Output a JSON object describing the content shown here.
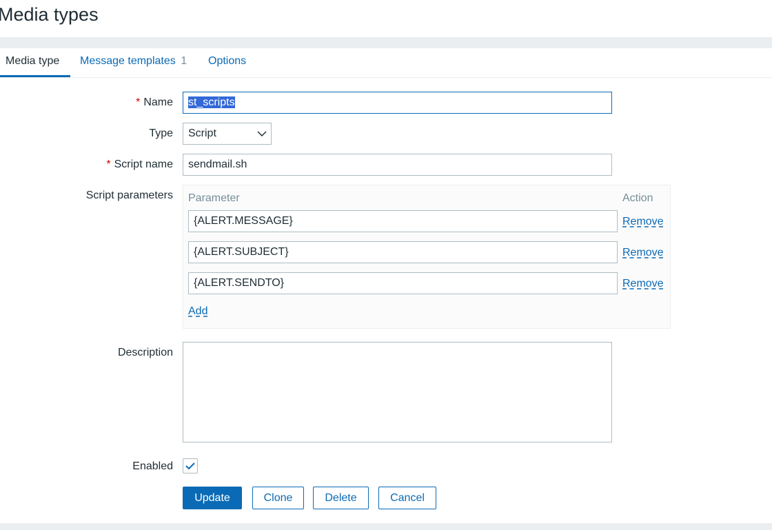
{
  "page": {
    "title": "Media types"
  },
  "tabs": [
    {
      "label": "Media type",
      "active": true
    },
    {
      "label": "Message templates",
      "count": "1"
    },
    {
      "label": "Options"
    }
  ],
  "form": {
    "name": {
      "label": "Name",
      "value": "st_scripts"
    },
    "type": {
      "label": "Type",
      "value": "Script"
    },
    "script_name": {
      "label": "Script name",
      "value": "sendmail.sh"
    },
    "script_parameters": {
      "label": "Script parameters",
      "col_parameter": "Parameter",
      "col_action": "Action",
      "rows": [
        {
          "value": "{ALERT.MESSAGE}",
          "action": "Remove"
        },
        {
          "value": "{ALERT.SUBJECT}",
          "action": "Remove"
        },
        {
          "value": "{ALERT.SENDTO}",
          "action": "Remove"
        }
      ],
      "add_label": "Add"
    },
    "description": {
      "label": "Description",
      "value": ""
    },
    "enabled": {
      "label": "Enabled",
      "checked": true
    }
  },
  "buttons": {
    "update": "Update",
    "clone": "Clone",
    "delete": "Delete",
    "cancel": "Cancel"
  },
  "colors": {
    "accent": "#0a6ab5",
    "required": "#d40000",
    "band": "#ebeef0"
  }
}
